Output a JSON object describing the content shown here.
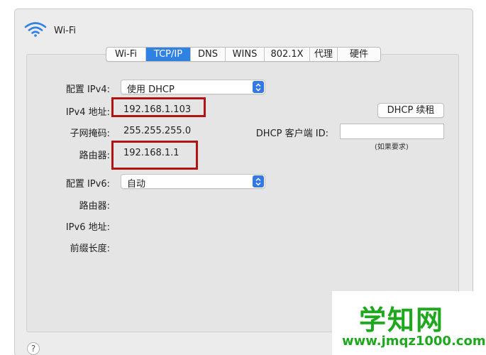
{
  "header": {
    "title": "Wi-Fi"
  },
  "tabs": [
    {
      "label": "Wi-Fi",
      "active": false
    },
    {
      "label": "TCP/IP",
      "active": true
    },
    {
      "label": "DNS",
      "active": false
    },
    {
      "label": "WINS",
      "active": false
    },
    {
      "label": "802.1X",
      "active": false
    },
    {
      "label": "代理",
      "active": false
    },
    {
      "label": "硬件",
      "active": false
    }
  ],
  "ipv4": {
    "config_label": "配置 IPv4:",
    "config_value": "使用 DHCP",
    "address_label": "IPv4 地址:",
    "address_value": "192.168.1.103",
    "subnet_label": "子网掩码:",
    "subnet_value": "255.255.255.0",
    "router_label": "路由器:",
    "router_value": "192.168.1.1",
    "renew_button": "DHCP 续租",
    "client_id_label": "DHCP 客户端 ID:",
    "client_id_value": "",
    "client_id_hint": "(如果要求)"
  },
  "ipv6": {
    "config_label": "配置 IPv6:",
    "config_value": "自动",
    "router_label": "路由器:",
    "address_label": "IPv6 地址:",
    "prefix_label": "前缀长度:"
  },
  "help_label": "?",
  "watermark": {
    "text": "学知网",
    "url": "www.jmqz1000.com"
  },
  "colors": {
    "accent": "#2f81e2",
    "highlight": "#b01515",
    "watermark": "#1ea81e"
  }
}
